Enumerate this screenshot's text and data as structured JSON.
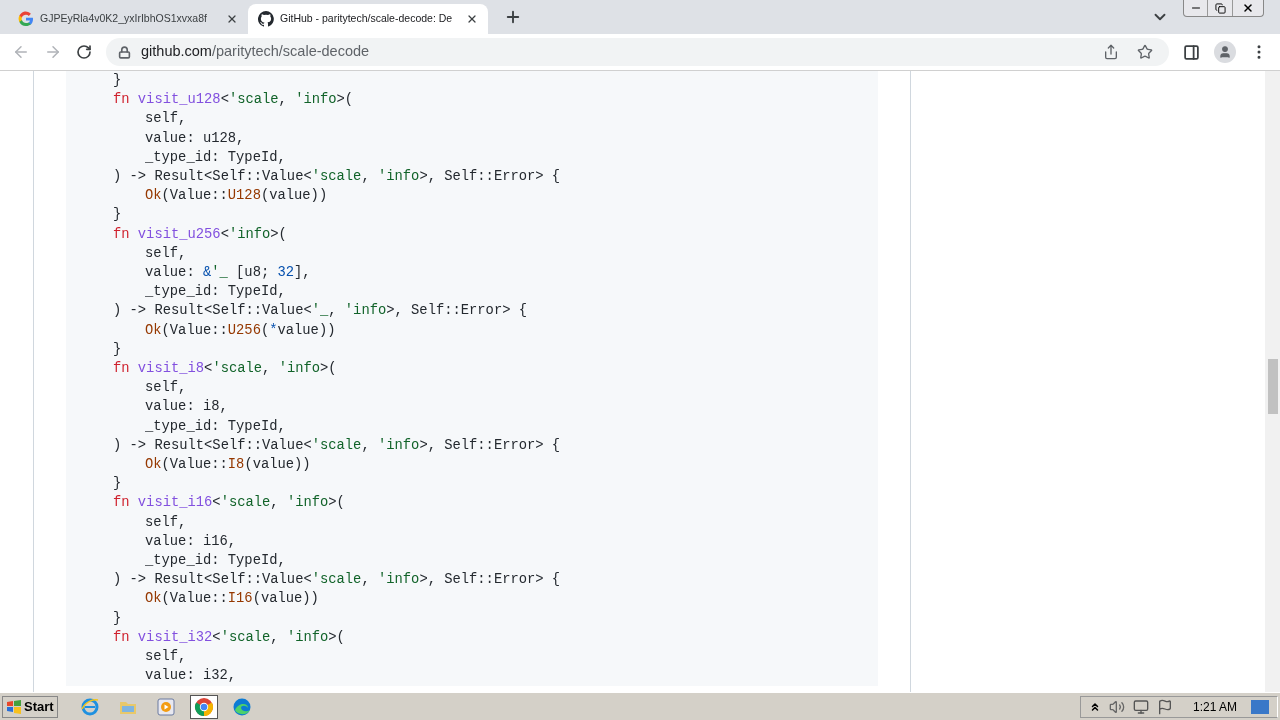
{
  "tabs": [
    {
      "title": "GJPEyRla4v0K2_yxIrIbhOS1xvxa8f",
      "kind": "google",
      "selected": false
    },
    {
      "title": "GitHub - paritytech/scale-decode: De",
      "kind": "github",
      "selected": true
    }
  ],
  "address": {
    "host": "github.com",
    "path": "/paritytech/scale-decode"
  },
  "code": {
    "lines": [
      {
        "kind": "signature",
        "tokens": [
          {
            "kind": "plain",
            "text": "}"
          }
        ]
      },
      {
        "kind": "signature",
        "tokens": [
          {
            "kind": "keyword",
            "text": "fn "
          },
          {
            "kind": "function",
            "text": "visit_u128"
          },
          {
            "kind": "plain",
            "text": "<"
          },
          {
            "kind": "lifetime",
            "text": "'scale"
          },
          {
            "kind": "plain",
            "text": ", "
          },
          {
            "kind": "lifetime",
            "text": "'info"
          },
          {
            "kind": "plain",
            "text": ">("
          }
        ]
      },
      {
        "kind": "body",
        "tokens": [
          {
            "kind": "plain",
            "text": "self,"
          }
        ]
      },
      {
        "kind": "body",
        "tokens": [
          {
            "kind": "plain",
            "text": "value: u128,"
          }
        ]
      },
      {
        "kind": "body",
        "tokens": [
          {
            "kind": "plain",
            "text": "_type_id: TypeId,"
          }
        ]
      },
      {
        "kind": "signature",
        "tokens": [
          {
            "kind": "plain",
            "text": ") -> Result<Self::Value<"
          },
          {
            "kind": "lifetime",
            "text": "'scale"
          },
          {
            "kind": "plain",
            "text": ", "
          },
          {
            "kind": "lifetime",
            "text": "'info"
          },
          {
            "kind": "plain",
            "text": ">, Self::Error> {"
          }
        ]
      },
      {
        "kind": "body",
        "tokens": [
          {
            "kind": "call",
            "text": "Ok"
          },
          {
            "kind": "plain",
            "text": "(Value::"
          },
          {
            "kind": "call",
            "text": "U128"
          },
          {
            "kind": "plain",
            "text": "(value))"
          }
        ]
      },
      {
        "kind": "signature",
        "tokens": [
          {
            "kind": "plain",
            "text": "}"
          }
        ]
      },
      {
        "kind": "signature",
        "tokens": [
          {
            "kind": "keyword",
            "text": "fn "
          },
          {
            "kind": "function",
            "text": "visit_u256"
          },
          {
            "kind": "plain",
            "text": "<"
          },
          {
            "kind": "lifetime",
            "text": "'info"
          },
          {
            "kind": "plain",
            "text": ">("
          }
        ]
      },
      {
        "kind": "body",
        "tokens": [
          {
            "kind": "plain",
            "text": "self,"
          }
        ]
      },
      {
        "kind": "body",
        "tokens": [
          {
            "kind": "plain",
            "text": "value: "
          },
          {
            "kind": "number",
            "text": "&"
          },
          {
            "kind": "lifetime",
            "text": "'_"
          },
          {
            "kind": "plain",
            "text": " [u8; "
          },
          {
            "kind": "number",
            "text": "32"
          },
          {
            "kind": "plain",
            "text": "],"
          }
        ]
      },
      {
        "kind": "body",
        "tokens": [
          {
            "kind": "plain",
            "text": "_type_id: TypeId,"
          }
        ]
      },
      {
        "kind": "signature",
        "tokens": [
          {
            "kind": "plain",
            "text": ") -> Result<Self::Value<"
          },
          {
            "kind": "lifetime",
            "text": "'_"
          },
          {
            "kind": "plain",
            "text": ", "
          },
          {
            "kind": "lifetime",
            "text": "'info"
          },
          {
            "kind": "plain",
            "text": ">, Self::Error> {"
          }
        ]
      },
      {
        "kind": "body",
        "tokens": [
          {
            "kind": "call",
            "text": "Ok"
          },
          {
            "kind": "plain",
            "text": "(Value::"
          },
          {
            "kind": "call",
            "text": "U256"
          },
          {
            "kind": "plain",
            "text": "("
          },
          {
            "kind": "number",
            "text": "*"
          },
          {
            "kind": "plain",
            "text": "value))"
          }
        ]
      },
      {
        "kind": "signature",
        "tokens": [
          {
            "kind": "plain",
            "text": "}"
          }
        ]
      },
      {
        "kind": "signature",
        "tokens": [
          {
            "kind": "keyword",
            "text": "fn "
          },
          {
            "kind": "function",
            "text": "visit_i8"
          },
          {
            "kind": "plain",
            "text": "<"
          },
          {
            "kind": "lifetime",
            "text": "'scale"
          },
          {
            "kind": "plain",
            "text": ", "
          },
          {
            "kind": "lifetime",
            "text": "'info"
          },
          {
            "kind": "plain",
            "text": ">("
          }
        ]
      },
      {
        "kind": "body",
        "tokens": [
          {
            "kind": "plain",
            "text": "self,"
          }
        ]
      },
      {
        "kind": "body",
        "tokens": [
          {
            "kind": "plain",
            "text": "value: i8,"
          }
        ]
      },
      {
        "kind": "body",
        "tokens": [
          {
            "kind": "plain",
            "text": "_type_id: TypeId,"
          }
        ]
      },
      {
        "kind": "signature",
        "tokens": [
          {
            "kind": "plain",
            "text": ") -> Result<Self::Value<"
          },
          {
            "kind": "lifetime",
            "text": "'scale"
          },
          {
            "kind": "plain",
            "text": ", "
          },
          {
            "kind": "lifetime",
            "text": "'info"
          },
          {
            "kind": "plain",
            "text": ">, Self::Error> {"
          }
        ]
      },
      {
        "kind": "body",
        "tokens": [
          {
            "kind": "call",
            "text": "Ok"
          },
          {
            "kind": "plain",
            "text": "(Value::"
          },
          {
            "kind": "call",
            "text": "I8"
          },
          {
            "kind": "plain",
            "text": "(value))"
          }
        ]
      },
      {
        "kind": "signature",
        "tokens": [
          {
            "kind": "plain",
            "text": "}"
          }
        ]
      },
      {
        "kind": "signature",
        "tokens": [
          {
            "kind": "keyword",
            "text": "fn "
          },
          {
            "kind": "function",
            "text": "visit_i16"
          },
          {
            "kind": "plain",
            "text": "<"
          },
          {
            "kind": "lifetime",
            "text": "'scale"
          },
          {
            "kind": "plain",
            "text": ", "
          },
          {
            "kind": "lifetime",
            "text": "'info"
          },
          {
            "kind": "plain",
            "text": ">("
          }
        ]
      },
      {
        "kind": "body",
        "tokens": [
          {
            "kind": "plain",
            "text": "self,"
          }
        ]
      },
      {
        "kind": "body",
        "tokens": [
          {
            "kind": "plain",
            "text": "value: i16,"
          }
        ]
      },
      {
        "kind": "body",
        "tokens": [
          {
            "kind": "plain",
            "text": "_type_id: TypeId,"
          }
        ]
      },
      {
        "kind": "signature",
        "tokens": [
          {
            "kind": "plain",
            "text": ") -> Result<Self::Value<"
          },
          {
            "kind": "lifetime",
            "text": "'scale"
          },
          {
            "kind": "plain",
            "text": ", "
          },
          {
            "kind": "lifetime",
            "text": "'info"
          },
          {
            "kind": "plain",
            "text": ">, Self::Error> {"
          }
        ]
      },
      {
        "kind": "body",
        "tokens": [
          {
            "kind": "call",
            "text": "Ok"
          },
          {
            "kind": "plain",
            "text": "(Value::"
          },
          {
            "kind": "call",
            "text": "I16"
          },
          {
            "kind": "plain",
            "text": "(value))"
          }
        ]
      },
      {
        "kind": "signature",
        "tokens": [
          {
            "kind": "plain",
            "text": "}"
          }
        ]
      },
      {
        "kind": "signature",
        "tokens": [
          {
            "kind": "keyword",
            "text": "fn "
          },
          {
            "kind": "function",
            "text": "visit_i32"
          },
          {
            "kind": "plain",
            "text": "<"
          },
          {
            "kind": "lifetime",
            "text": "'scale"
          },
          {
            "kind": "plain",
            "text": ", "
          },
          {
            "kind": "lifetime",
            "text": "'info"
          },
          {
            "kind": "plain",
            "text": ">("
          }
        ]
      },
      {
        "kind": "body",
        "tokens": [
          {
            "kind": "plain",
            "text": "self,"
          }
        ]
      },
      {
        "kind": "body",
        "tokens": [
          {
            "kind": "plain",
            "text": "value: i32,"
          }
        ]
      }
    ]
  },
  "taskbar": {
    "start": "Start",
    "apps": [
      {
        "kind": "ie",
        "selected": false
      },
      {
        "kind": "folder",
        "selected": false
      },
      {
        "kind": "media",
        "selected": false
      },
      {
        "kind": "chrome",
        "selected": true
      },
      {
        "kind": "edge",
        "selected": false
      }
    ],
    "clock": "1:21 AM"
  }
}
